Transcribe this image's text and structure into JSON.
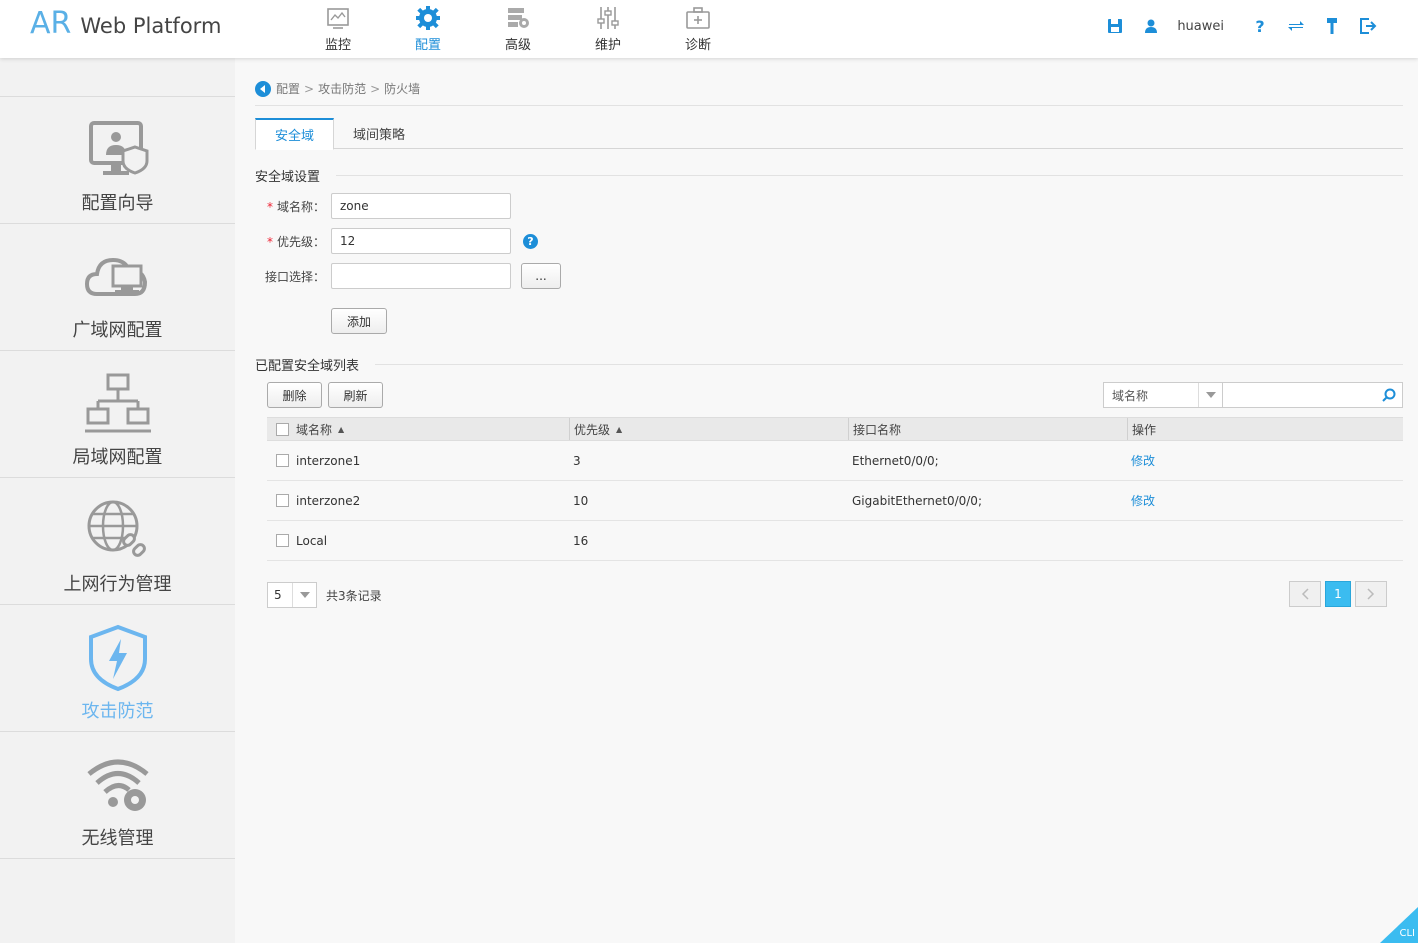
{
  "app": {
    "logo_ar": "AR",
    "logo_wp": "Web Platform"
  },
  "topnav": [
    {
      "label": "监控",
      "icon": "monitor-icon"
    },
    {
      "label": "配置",
      "icon": "gear-icon",
      "active": true
    },
    {
      "label": "高级",
      "icon": "advanced-icon"
    },
    {
      "label": "维护",
      "icon": "sliders-icon"
    },
    {
      "label": "诊断",
      "icon": "medkit-icon"
    }
  ],
  "header": {
    "username": "huawei"
  },
  "sidebar": [
    {
      "label": "配置向导",
      "icon": "config-wizard-icon"
    },
    {
      "label": "广域网配置",
      "icon": "cloud-computer-icon"
    },
    {
      "label": "局域网配置",
      "icon": "lan-topology-icon"
    },
    {
      "label": "上网行为管理",
      "icon": "globe-link-icon"
    },
    {
      "label": "攻击防范",
      "icon": "shield-bolt-icon",
      "active": true
    },
    {
      "label": "无线管理",
      "icon": "wifi-gear-icon"
    }
  ],
  "breadcrumb": [
    "配置",
    "攻击防范",
    "防火墙"
  ],
  "tabs": [
    {
      "label": "安全域",
      "active": true
    },
    {
      "label": "域间策略"
    }
  ],
  "zone_settings": {
    "title": "安全域设置",
    "name_label": "域名称：",
    "name_value": "zone",
    "priority_label": "优先级：",
    "priority_value": "12",
    "interface_label": "接口选择：",
    "interface_value": "",
    "browse_label": "...",
    "add_label": "添加"
  },
  "zone_list": {
    "title": "已配置安全域列表",
    "delete_label": "删除",
    "refresh_label": "刷新",
    "search_field": "域名称",
    "columns": [
      "域名称",
      "优先级",
      "接口名称",
      "操作"
    ],
    "rows": [
      {
        "name": "interzone1",
        "priority": "3",
        "interface": "Ethernet0/0/0;",
        "action": "修改"
      },
      {
        "name": "interzone2",
        "priority": "10",
        "interface": "GigabitEthernet0/0/0;",
        "action": "修改"
      },
      {
        "name": "Local",
        "priority": "16",
        "interface": "",
        "action": ""
      }
    ],
    "page_size": "5",
    "total": "共3条记录",
    "current_page": "1"
  },
  "cli_label": "CLI",
  "colors": {
    "accent": "#1d8ed8",
    "active_side": "#6cb6ef",
    "page_active": "#3bbcf0"
  }
}
